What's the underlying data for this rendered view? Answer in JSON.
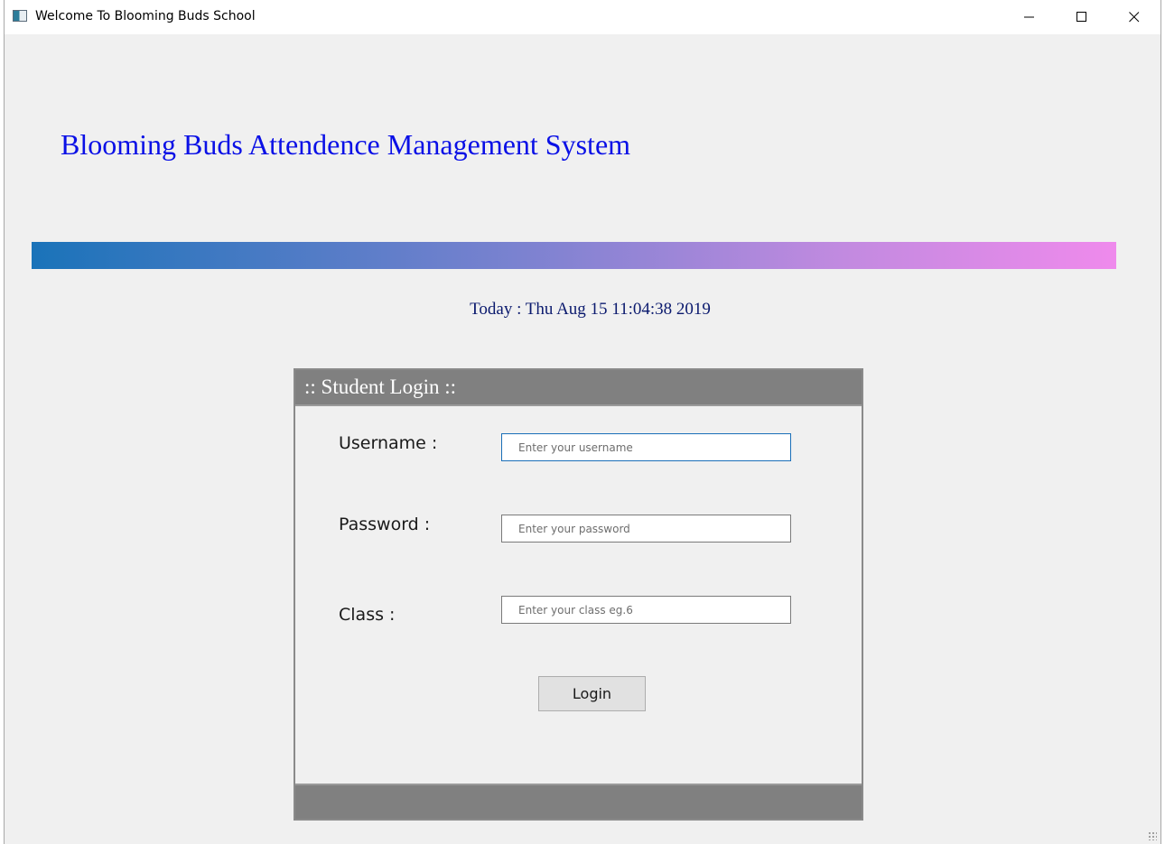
{
  "window": {
    "title": "Welcome To Blooming Buds School",
    "icons": {
      "app": "app-window-icon",
      "minimize": "minimize-icon",
      "maximize": "maximize-icon",
      "close": "close-icon"
    }
  },
  "header": {
    "title": "Blooming Buds Attendence Management System",
    "title_color": "#0a10e6",
    "banner_colors": [
      "#1a73b9",
      "#7b82d0",
      "#c28ae0",
      "#ef8aec"
    ]
  },
  "date": {
    "text": "Today : Thu Aug 15 11:04:38 2019",
    "color": "#0b1a6e"
  },
  "login_panel": {
    "title": ":: Student Login ::",
    "header_color": "#808080",
    "fields": [
      {
        "label": "Username :",
        "placeholder": "Enter your username",
        "value": ""
      },
      {
        "label": "Password :",
        "placeholder": "Enter your password",
        "value": ""
      },
      {
        "label": "Class :",
        "placeholder": "Enter your class eg.6",
        "value": ""
      }
    ],
    "submit_label": "Login"
  }
}
